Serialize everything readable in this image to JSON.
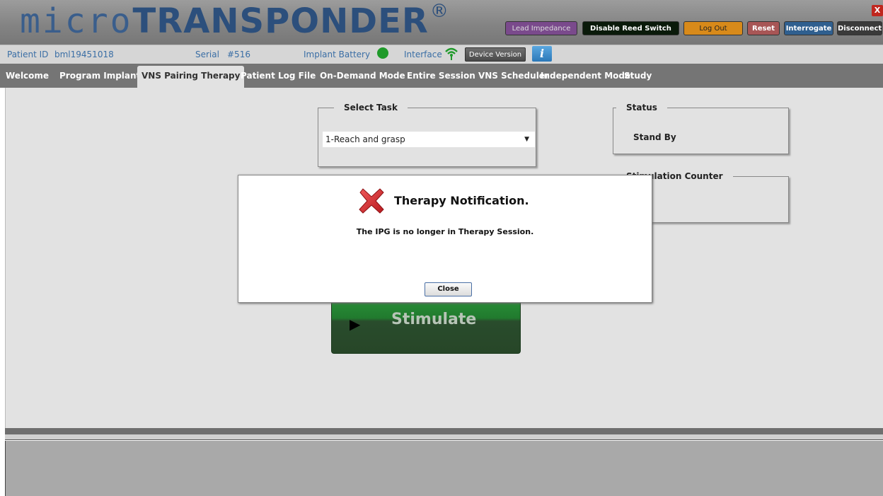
{
  "header": {
    "logo_micro": "micro",
    "logo_transponder": "TRANSPONDER",
    "logo_reg": "®",
    "buttons": {
      "lead_impedance": "Lead Impedance",
      "disable_reed_switch": "Disable Reed Switch",
      "log_out": "Log Out",
      "reset": "Reset",
      "interrogate": "Interrogate",
      "disconnect": "Disconnect",
      "close_x": "X"
    }
  },
  "infobar": {
    "patient_id_label": "Patient ID",
    "patient_id_value": "bml19451018",
    "serial_label": "Serial",
    "serial_value": "#516",
    "implant_battery_label": "Implant Battery",
    "battery_status_color": "#1f9a2a",
    "interface_label": "Interface",
    "device_version_button": "Device Version",
    "info_icon": "i"
  },
  "tabs": [
    {
      "label": "Welcome"
    },
    {
      "label": "Program Implant"
    },
    {
      "label": "VNS Pairing Therapy"
    },
    {
      "label": "Patient Log File"
    },
    {
      "label": "On-Demand Mode"
    },
    {
      "label": "Entire Session VNS Scheduler"
    },
    {
      "label": "Independent Mode"
    },
    {
      "label": "Study"
    }
  ],
  "main": {
    "select_task": {
      "title": "Select Task",
      "selected": "1-Reach and grasp"
    },
    "status": {
      "title": "Status",
      "value": "Stand By"
    },
    "stimulation_counter": {
      "title": "Stimulation Counter"
    },
    "stimulate_button": "Stimulate"
  },
  "dialog": {
    "title": "Therapy Notification.",
    "message": "The IPG is no longer in Therapy Session.",
    "close_button": "Close"
  },
  "colors": {
    "accent_blue": "#3a6ea5",
    "error_red": "#d42a2a",
    "stimulate_green": "#2c9a3c"
  }
}
